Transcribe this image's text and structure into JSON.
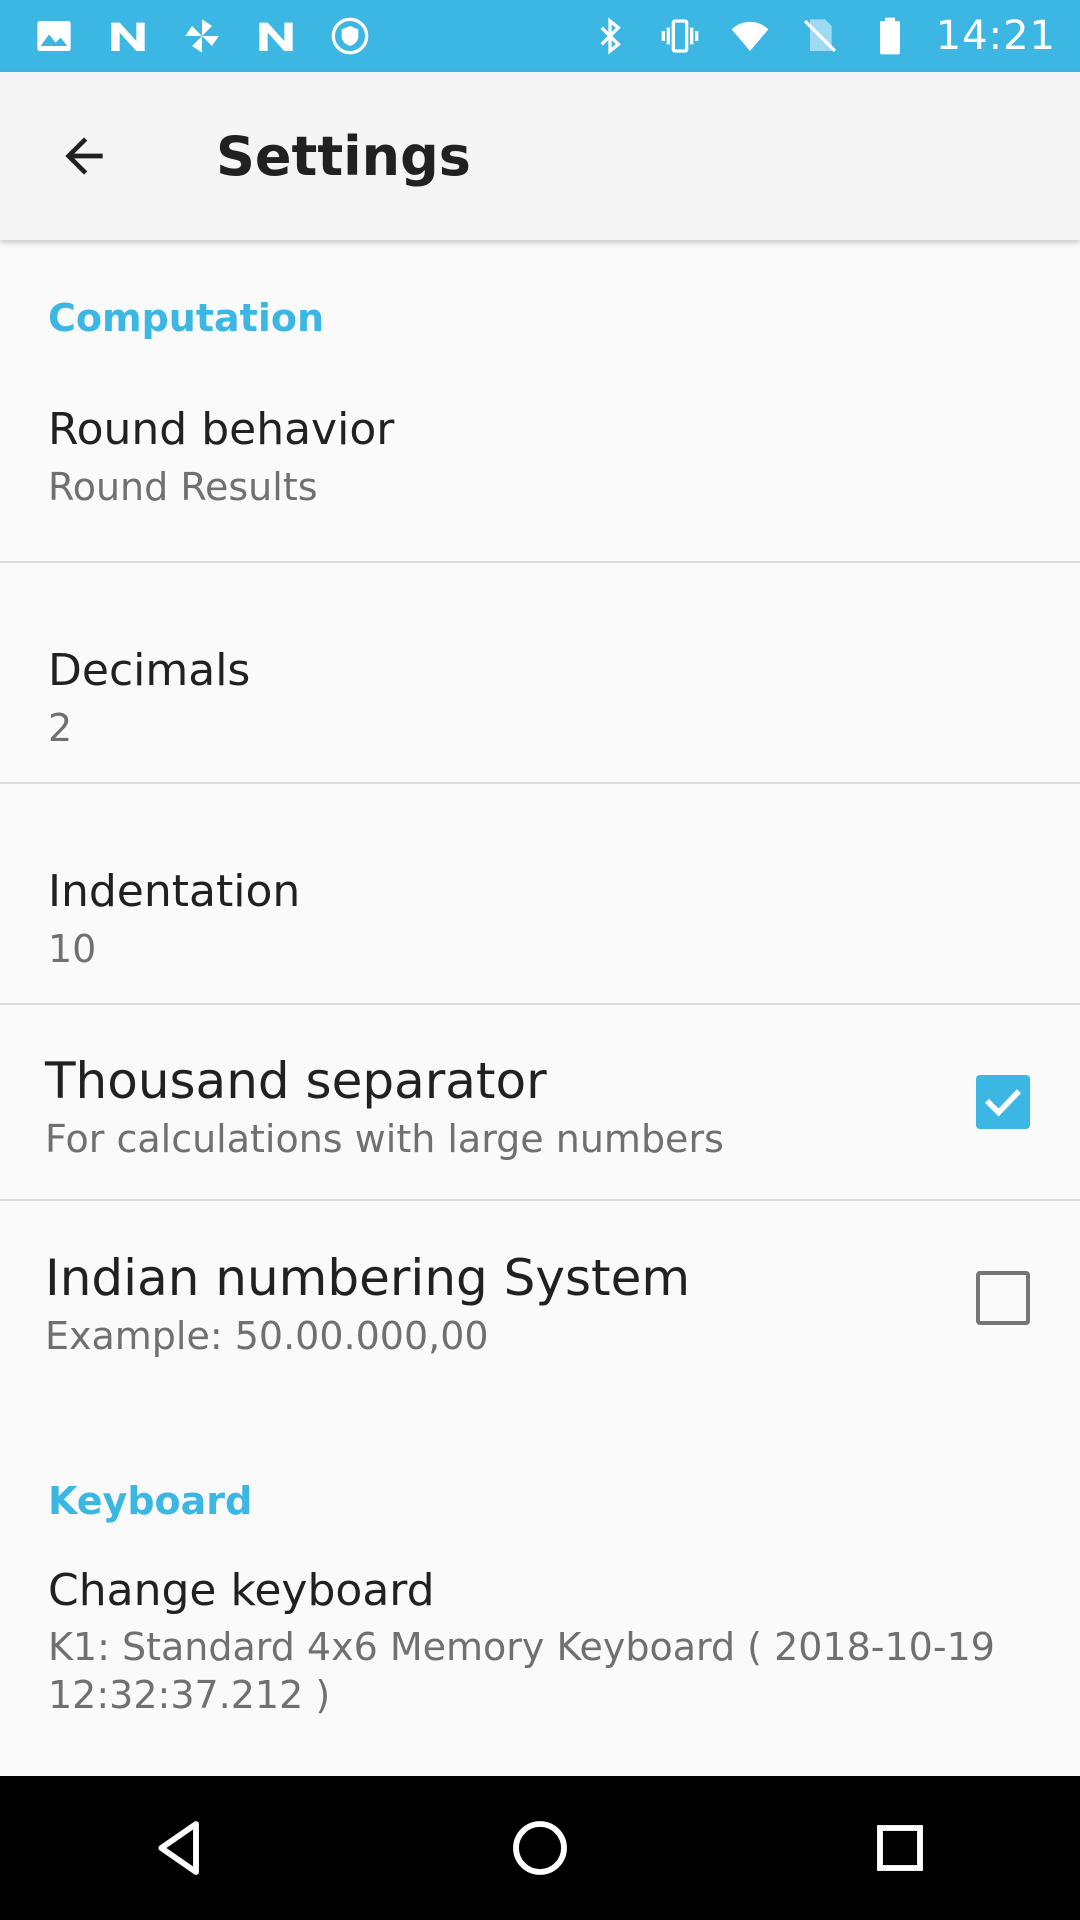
{
  "status_bar": {
    "time": "14:21",
    "left_icons": [
      "image-icon",
      "n-logo-icon",
      "pinwheel-icon",
      "n-logo-icon",
      "shield-icon"
    ],
    "right_icons": [
      "bluetooth-icon",
      "vibrate-icon",
      "wifi-icon",
      "no-sim-icon",
      "battery-icon"
    ],
    "background": "#3cb7e4"
  },
  "app_bar": {
    "title": "Settings",
    "back_icon": "arrow-left-icon"
  },
  "sections": {
    "computation": {
      "header": "Computation",
      "round_behavior": {
        "title": "Round behavior",
        "summary": "Round Results"
      },
      "decimals": {
        "title": "Decimals",
        "summary": "2"
      },
      "indentation": {
        "title": "Indentation",
        "summary": "10"
      },
      "thousand_separator": {
        "title": "Thousand separator",
        "summary": "For calculations with large numbers",
        "checked": true
      },
      "indian_numbering": {
        "title": "Indian numbering System",
        "summary": "Example: 50.00.000,00",
        "checked": false
      }
    },
    "keyboard": {
      "header": "Keyboard",
      "change_keyboard": {
        "title": "Change keyboard",
        "summary": "K1: Standard 4x6 Memory Keyboard ( 2018-10-19 12:32:37.212 )"
      }
    }
  },
  "nav_bar": {
    "buttons": [
      "back-triangle-icon",
      "home-circle-icon",
      "recents-square-icon"
    ]
  },
  "colors": {
    "accent": "#3cb7e4",
    "text_primary": "#212121",
    "text_secondary": "#707070",
    "divider": "#dcdcdc"
  }
}
